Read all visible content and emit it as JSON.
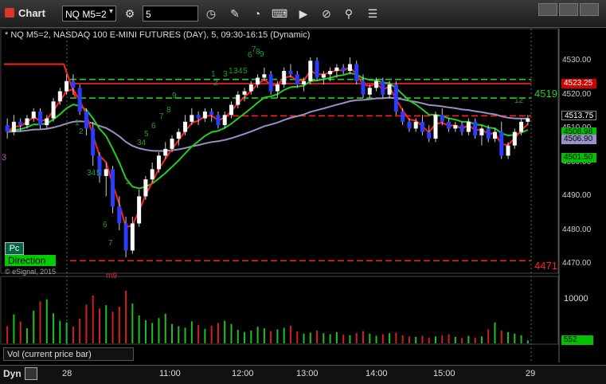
{
  "window": {
    "title": "Chart",
    "symbol_value": "NQ M5=2",
    "interval_value": "5"
  },
  "toolbar_icons": [
    "gear-icon",
    "clock-icon",
    "pencil-icon",
    "speedometer-icon",
    "keyboard-icon",
    "play-icon",
    "tag-icon",
    "link-icon",
    "list-icon"
  ],
  "chart_header": "* NQ M5=2, NASDAQ 100 E-MINI FUTURES (DAY), 5, 09:30-16:15 (Dynamic)",
  "price_axis": [
    "4530.00",
    "4520.00",
    "4510.00",
    "4500.00",
    "4490.00",
    "4480.00",
    "4470.00"
  ],
  "price_tags": [
    {
      "label": "4523.25",
      "bg": "#d40000",
      "fg": "#ffffff",
      "price": 4523.25
    },
    {
      "label": "4513.75",
      "bg": "#000000",
      "fg": "#ffffff",
      "price": 4513.75
    },
    {
      "label": "4508.98",
      "bg": "#00c000",
      "fg": "#000000",
      "price": 4508.98
    },
    {
      "label": "4506.90",
      "bg": "#9a8fc8",
      "fg": "#000000",
      "price": 4506.9
    },
    {
      "label": "4501.50",
      "bg": "#00c000",
      "fg": "#000000",
      "price": 4501.5
    }
  ],
  "line_labels": {
    "upper": "4519",
    "lower": "4471"
  },
  "left_labels": {
    "marker": "3"
  },
  "badges": {
    "pc": "Pc",
    "direction": "Direction",
    "copyright": "© eSignal, 2015"
  },
  "count_labels": {
    "bottom_marker": "m9",
    "seq_top": [
      "1",
      "3",
      "4",
      "5",
      "6",
      "7",
      "8",
      "9"
    ],
    "seq_mid": [
      "2",
      "1",
      "3"
    ],
    "seq_left": [
      "1",
      "2",
      "34",
      "5",
      "6",
      "7"
    ],
    "seq_rise": [
      "1",
      "34",
      "5",
      "6",
      "7",
      "8",
      "9"
    ],
    "end_label": "12"
  },
  "volume": {
    "label": "Vol (current price bar)",
    "axis_top": "10000",
    "current": "552"
  },
  "footer": {
    "dyn_label": "Dyn",
    "x_ticks": [
      "28",
      "11:00",
      "12:00",
      "13:00",
      "14:00",
      "15:00",
      "29"
    ]
  },
  "chart_data": {
    "type": "candlestick",
    "ylim": [
      4468,
      4535
    ],
    "series_candles": [
      [
        4511,
        4513,
        4507,
        4509
      ],
      [
        4509,
        4514,
        4508,
        4512
      ],
      [
        4512,
        4513,
        4509,
        4511
      ],
      [
        4511,
        4514,
        4510,
        4513
      ],
      [
        4513,
        4516,
        4512,
        4515
      ],
      [
        4515,
        4516,
        4510,
        4511
      ],
      [
        4511,
        4514,
        4510,
        4513
      ],
      [
        4513,
        4519,
        4512,
        4518
      ],
      [
        4518,
        4522,
        4517,
        4521
      ],
      [
        4521,
        4526,
        4520,
        4524
      ],
      [
        4524,
        4526,
        4520,
        4522
      ],
      [
        4522,
        4523,
        4514,
        4515
      ],
      [
        4515,
        4516,
        4508,
        4510
      ],
      [
        4510,
        4512,
        4499,
        4502
      ],
      [
        4502,
        4503,
        4494,
        4496
      ],
      [
        4496,
        4500,
        4490,
        4498
      ],
      [
        4498,
        4499,
        4485,
        4487
      ],
      [
        4487,
        4490,
        4480,
        4482
      ],
      [
        4482,
        4484,
        4472,
        4474
      ],
      [
        4474,
        4484,
        4473,
        4482
      ],
      [
        4482,
        4492,
        4481,
        4490
      ],
      [
        4490,
        4496,
        4489,
        4495
      ],
      [
        4495,
        4500,
        4494,
        4498
      ],
      [
        4498,
        4503,
        4497,
        4502
      ],
      [
        4502,
        4506,
        4501,
        4504
      ],
      [
        4504,
        4508,
        4503,
        4507
      ],
      [
        4507,
        4510,
        4505,
        4509
      ],
      [
        4509,
        4514,
        4508,
        4512
      ],
      [
        4512,
        4516,
        4511,
        4514
      ],
      [
        4514,
        4515,
        4511,
        4513
      ],
      [
        4513,
        4516,
        4512,
        4515
      ],
      [
        4515,
        4516,
        4512,
        4514
      ],
      [
        4514,
        4515,
        4510,
        4511
      ],
      [
        4511,
        4515,
        4510,
        4514
      ],
      [
        4514,
        4518,
        4513,
        4517
      ],
      [
        4517,
        4521,
        4516,
        4520
      ],
      [
        4520,
        4522,
        4518,
        4521
      ],
      [
        4521,
        4524,
        4520,
        4523
      ],
      [
        4523,
        4526,
        4522,
        4525
      ],
      [
        4525,
        4528,
        4524,
        4526
      ],
      [
        4526,
        4527,
        4520,
        4521
      ],
      [
        4521,
        4524,
        4519,
        4523
      ],
      [
        4523,
        4528,
        4522,
        4527
      ],
      [
        4527,
        4529,
        4525,
        4526
      ],
      [
        4526,
        4527,
        4522,
        4523
      ],
      [
        4523,
        4525,
        4521,
        4524
      ],
      [
        4524,
        4531,
        4523,
        4530
      ],
      [
        4530,
        4531,
        4524,
        4525
      ],
      [
        4525,
        4527,
        4523,
        4526
      ],
      [
        4526,
        4528,
        4524,
        4527
      ],
      [
        4527,
        4529,
        4525,
        4528
      ],
      [
        4528,
        4529,
        4526,
        4527
      ],
      [
        4527,
        4531,
        4526,
        4529
      ],
      [
        4529,
        4530,
        4523,
        4524
      ],
      [
        4524,
        4526,
        4519,
        4520
      ],
      [
        4520,
        4523,
        4519,
        4522
      ],
      [
        4522,
        4525,
        4521,
        4524
      ],
      [
        4524,
        4525,
        4519,
        4520
      ],
      [
        4520,
        4524,
        4519,
        4523
      ],
      [
        4523,
        4524,
        4514,
        4515
      ],
      [
        4515,
        4516,
        4511,
        4512
      ],
      [
        4512,
        4513,
        4509,
        4510
      ],
      [
        4510,
        4513,
        4509,
        4512
      ],
      [
        4512,
        4514,
        4508,
        4509
      ],
      [
        4509,
        4511,
        4506,
        4507
      ],
      [
        4507,
        4515,
        4506,
        4514
      ],
      [
        4514,
        4516,
        4511,
        4512
      ],
      [
        4512,
        4513,
        4509,
        4510
      ],
      [
        4510,
        4512,
        4509,
        4511
      ],
      [
        4511,
        4512,
        4508,
        4509
      ],
      [
        4509,
        4513,
        4508,
        4512
      ],
      [
        4512,
        4513,
        4507,
        4508
      ],
      [
        4508,
        4511,
        4505,
        4510
      ],
      [
        4510,
        4511,
        4506,
        4507
      ],
      [
        4507,
        4510,
        4506,
        4509
      ],
      [
        4509,
        4512,
        4501,
        4502
      ],
      [
        4502,
        4506,
        4501,
        4505
      ],
      [
        4505,
        4510,
        4504,
        4509
      ],
      [
        4509,
        4513,
        4508,
        4512
      ],
      [
        4512,
        4514,
        4511,
        4513
      ]
    ],
    "volume_values": [
      3200,
      5400,
      4100,
      2800,
      6100,
      7800,
      8200,
      5600,
      4200,
      3900,
      3100,
      4600,
      7200,
      8900,
      6500,
      7100,
      5900,
      6800,
      9800,
      7400,
      5200,
      4300,
      3800,
      4700,
      5500,
      3600,
      3200,
      2900,
      4100,
      3400,
      2700,
      3300,
      3800,
      4200,
      3600,
      2500,
      2100,
      2400,
      3100,
      2800,
      2300,
      2600,
      2900,
      3300,
      2200,
      1800,
      2000,
      2400,
      1900,
      1700,
      2100,
      1600,
      1500,
      1900,
      2300,
      1800,
      1400,
      1700,
      1900,
      2000,
      1500,
      1300,
      1200,
      1400,
      1100,
      1300,
      1500,
      1700,
      1200,
      1000,
      1400,
      1100,
      1300,
      2600,
      3900,
      2400,
      2100,
      1800,
      1500,
      552
    ],
    "horizontal_lines": [
      {
        "price": 4523.25,
        "color": "#ff2020",
        "style": "solid"
      },
      {
        "price": 4519,
        "color": "#20d020",
        "style": "dashed"
      },
      {
        "price": 4513.75,
        "color": "#ff2020",
        "style": "dashed"
      },
      {
        "price": 4471,
        "color": "#ff2020",
        "style": "dashed"
      },
      {
        "price": 4524.5,
        "color": "#20d020",
        "style": "dashed"
      }
    ]
  }
}
